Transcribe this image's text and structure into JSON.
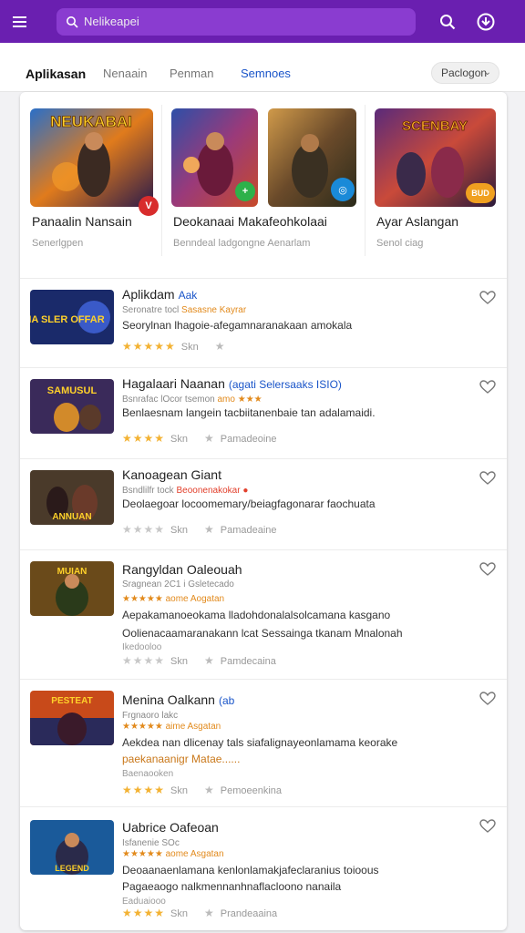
{
  "header": {
    "search_placeholder": "Nelikeapei",
    "icons": [
      "menu-icon",
      "search-icon",
      "search-icon",
      "account-icon"
    ],
    "color": "#6a1fb0"
  },
  "tabs": [
    {
      "label": "Aplikasan"
    },
    {
      "label": "Nenaain"
    },
    {
      "label": "Penman"
    },
    {
      "label": "Semnoes"
    }
  ],
  "filter": {
    "label": "Paclogon",
    "icon": "chevron-down-icon"
  },
  "featured": [
    {
      "title": "Panaalin Nansain",
      "sub": "Senerlgpen",
      "badge_color": "#d82c2c",
      "badge_text": "V",
      "thumb_text": "NEUKABAI"
    },
    {
      "title": "Deokanaai Makafeohkolaai",
      "sub": "Benndeal ladgongne Aenarlam",
      "badge_color": "#2db14a",
      "badge_text": "+",
      "thumb_text": ""
    },
    {
      "title": "",
      "sub": "",
      "badge_color": "#1a8ad8",
      "badge_text": "◎",
      "thumb_text": ""
    },
    {
      "title": "Ayar Aslangan",
      "sub": "Senol ciag",
      "badge_color": "#f0a020",
      "badge_text": "BUD",
      "thumb_text": "SCENBAY"
    }
  ],
  "list": [
    {
      "title": "Aplikdam",
      "tag": "Aak",
      "meta_a": "Seronatre tocl",
      "meta_b": "Sasasne",
      "meta_c": "Kayrar",
      "desc": "Seorylnan lhagoie-afegamnaranakaan amokala",
      "desc2": "",
      "extra": "",
      "stars": "★★★★★",
      "stars_grey": "",
      "star_label": "Skn",
      "second_label": "",
      "thumb_text": "DIA SLER OFFAR"
    },
    {
      "title": "Hagalaari Naanan",
      "tag": "(agati Selersaaks ISIO)",
      "meta_a": "Bsnrafac lOcor",
      "meta_b": "tsemon",
      "meta_c": "amo ★★★",
      "desc": "Benlaesnam langein tacbiitanenbaie tan adalamaidi.",
      "desc2": "",
      "extra": "",
      "stars": "★★★★",
      "stars_grey": "",
      "star_label": "Skn",
      "second_label": "Pamadeoine",
      "thumb_text": "SAMUSUL"
    },
    {
      "title": "Kanoagean Giant",
      "tag": "",
      "meta_a": "Bsndlilfr tock",
      "meta_b": "Beoonenakokar",
      "meta_c": "",
      "desc": "Deolaegoar locoomemary/beiagfagonarar faochuata",
      "desc2": "",
      "extra": "",
      "stars": "",
      "stars_grey": "★★★★",
      "star_label": "Skn",
      "second_label": "Pamadeaine",
      "thumb_text": "ANNUAN"
    },
    {
      "title": "Rangyldan Oaleouah",
      "tag": "",
      "meta_a": "Sragnean 2C1 i Gsletecado",
      "meta_b": "",
      "meta_c": "",
      "meta_line2": "★★★★★ aome  Aogatan",
      "desc": "Aepakamanoeokama lladohdonalalsolcamana kasgano",
      "desc2": "Oolienacaamaranakann lcat Sessainga tkanam Mnalonah",
      "extra": "Ikedooloo",
      "stars": "",
      "stars_grey": "★★★★",
      "star_label": "Skn",
      "second_label": "Pamdecaina",
      "thumb_text": "MUIAN"
    },
    {
      "title": "Menina Oalkann",
      "tag": "(ab",
      "meta_a": "Frgnaoro lakc",
      "meta_b": "",
      "meta_c": "",
      "meta_line2": "★★★★★ aime  Asgatan",
      "desc": "Aekdea nan dlicenay tals siafalignayeonlamama keorake",
      "desc2": "paekanaanigr  Matae......",
      "extra": "Baenaooken",
      "stars": "★★★★",
      "stars_grey": "",
      "star_label": "Skn",
      "second_label": "Pemoeenkina",
      "thumb_text": "PESTEAT"
    },
    {
      "title": "Uabrice Oafeoan",
      "tag": "",
      "meta_a": "Isfanenie SOc",
      "meta_b": "",
      "meta_c": "",
      "meta_line2": "★★★★★ aome  Asgatan",
      "desc": "Deoaanaenlamana kenlonlamakjafeclaranius toioous",
      "desc2": "Pagaeaogo nalkmennanhnaflacloono nanaila",
      "extra": "Eaduaiooo",
      "stars": "★★★★",
      "stars_grey": "",
      "star_label": "Skn",
      "second_label": "Prandeaaina",
      "thumb_text": "LEGEND"
    }
  ]
}
